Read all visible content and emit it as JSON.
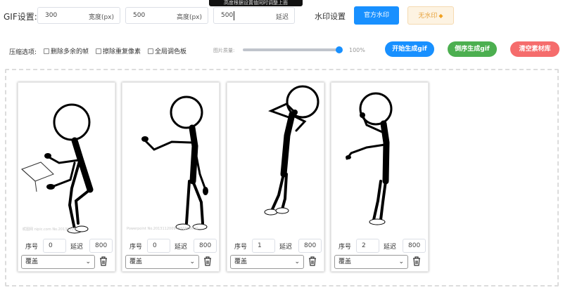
{
  "tooltip": "高度根据设置值同时调整上面",
  "gif": {
    "label": "GIF设置:",
    "width_value": "300",
    "width_unit": "宽度(px)",
    "height_value": "500",
    "height_unit": "高度(px)",
    "delay_value": "500",
    "delay_unit": "延迟"
  },
  "watermark": {
    "label": "水印设置",
    "official_label": "官方水印",
    "none_label": "无水印"
  },
  "compress": {
    "label": "压缩选项:",
    "options": [
      "删除多余的帧",
      "擦除重复像素",
      "全局调色板"
    ],
    "quality_label": "图片质量:",
    "quality_value": "100%",
    "quality_fraction": 1.0
  },
  "actions": {
    "start_label": "开始生成gif",
    "reverse_label": "倒序生成gif",
    "clear_label": "清空素材库"
  },
  "frames": [
    {
      "seq_label": "序号",
      "seq": "0",
      "delay_label": "延迟",
      "delay": "800",
      "mode": "覆盖",
      "pose": "box",
      "wm_text": "昵图网  nipic.com  No.20131120..."
    },
    {
      "seq_label": "序号",
      "seq": "0",
      "delay_label": "延迟",
      "delay": "800",
      "mode": "覆盖",
      "pose": "reach",
      "wm_text": "Powerpoint No.20131120094931988000"
    },
    {
      "seq_label": "序号",
      "seq": "1",
      "delay_label": "延迟",
      "delay": "800",
      "mode": "覆盖",
      "pose": "head",
      "wm_text": ""
    },
    {
      "seq_label": "序号",
      "seq": "2",
      "delay_label": "延迟",
      "delay": "800",
      "mode": "覆盖",
      "pose": "think",
      "wm_text": ""
    }
  ],
  "colors": {
    "primary": "#1890ff",
    "green": "#4caf50",
    "red": "#f56c6c",
    "warning": "#e6a23c"
  }
}
